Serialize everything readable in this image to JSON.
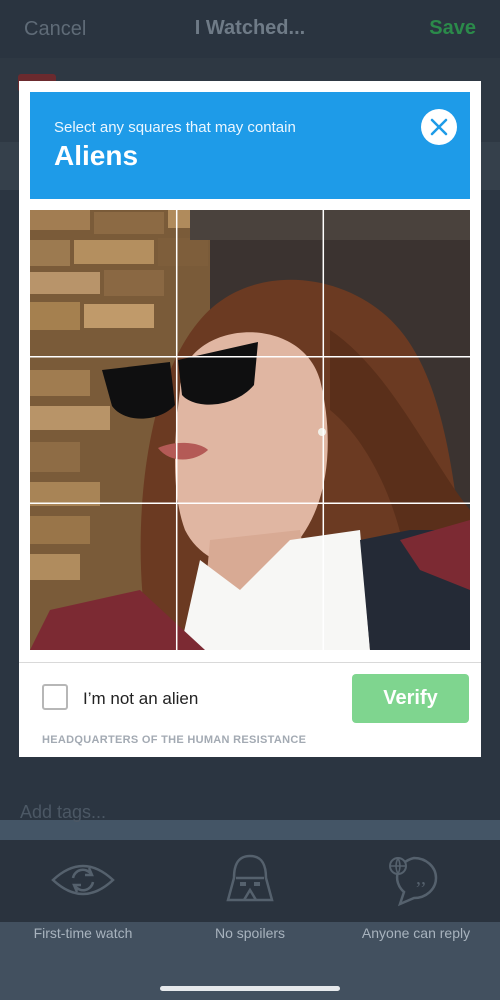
{
  "nav": {
    "cancel_label": "Cancel",
    "title": "I Watched...",
    "save_label": "Save"
  },
  "tags_placeholder": "Add tags...",
  "options": [
    {
      "label": "First-time watch",
      "icon": "eye-rewatch-icon"
    },
    {
      "label": "No spoilers",
      "icon": "darth-vader-icon"
    },
    {
      "label": "Anyone can reply",
      "icon": "speech-bubble-globe-icon"
    }
  ],
  "captcha": {
    "instruction": "Select any squares that may contain",
    "target": "Aliens",
    "checkbox_label": "I’m not an alien",
    "verify_label": "Verify",
    "footer": "HEADQUARTERS OF THE HUMAN RESISTANCE",
    "image_description": "photo",
    "grid": {
      "rows": 3,
      "cols": 3
    },
    "colors": {
      "header": "#1e9be8",
      "verify": "#7fd58f"
    }
  }
}
